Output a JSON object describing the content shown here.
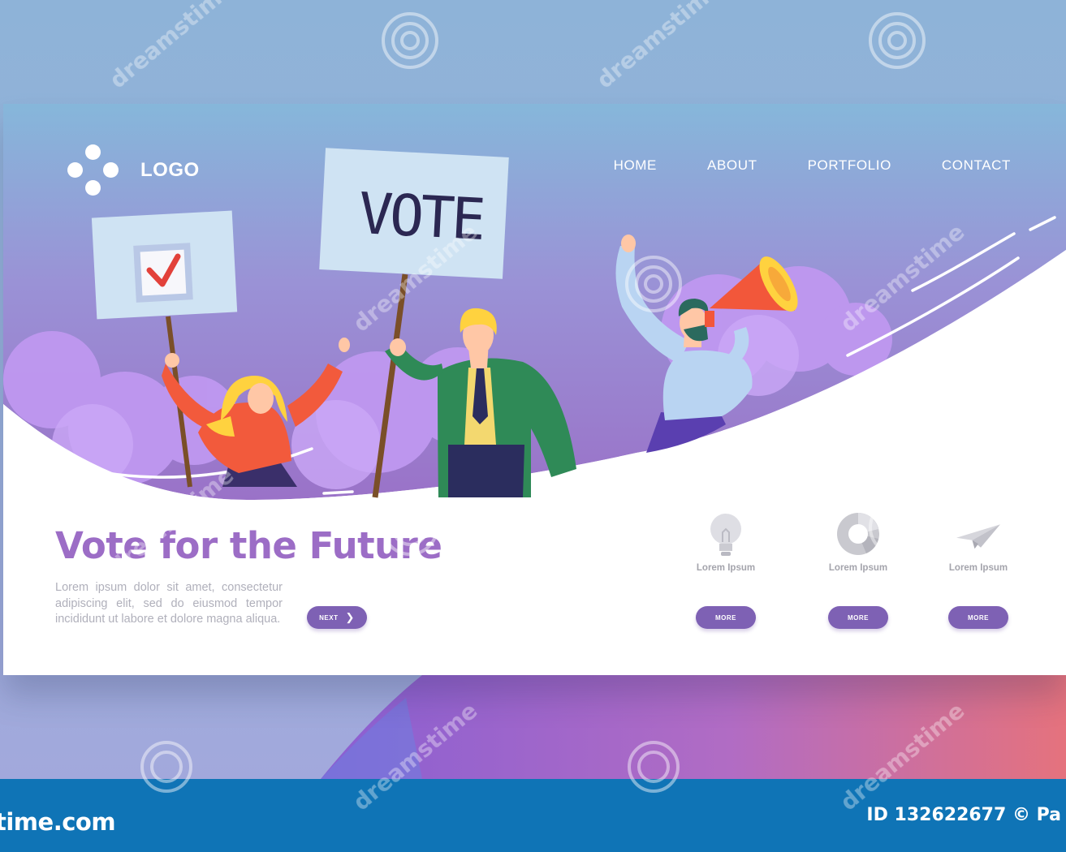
{
  "nav": {
    "logo_text": "LOGO",
    "items": [
      {
        "label": "HOME"
      },
      {
        "label": "ABOUT"
      },
      {
        "label": "PORTFOLIO"
      },
      {
        "label": "CONTACT"
      }
    ]
  },
  "hero": {
    "vote_sign": "VOTE",
    "checkbox_sign": "checkmark"
  },
  "main": {
    "headline": "Vote for the Future",
    "body": "Lorem ipsum dolor sit amet, consectetur adipiscing elit, sed do eiusmod tempor incididunt ut labore et dolore magna aliqua.",
    "next_label": "NEXT"
  },
  "features": [
    {
      "icon": "lightbulb-icon",
      "label": "Lorem Ipsum",
      "button": "MORE"
    },
    {
      "icon": "pie-chart-icon",
      "label": "Lorem Ipsum",
      "button": "MORE"
    },
    {
      "icon": "paper-plane-icon",
      "label": "Lorem Ipsum",
      "button": "MORE"
    }
  ],
  "footer": {
    "brand": "time.com",
    "id_text": "ID 132622677 © Pa"
  },
  "watermark": {
    "text": "dreamstime"
  },
  "colors": {
    "accent_purple": "#7e61b4",
    "headline_purple": "#9c6dc6",
    "footer_blue": "#0f74b6",
    "sky_top": "#86b7da",
    "sky_bottom": "#9a72c8"
  }
}
